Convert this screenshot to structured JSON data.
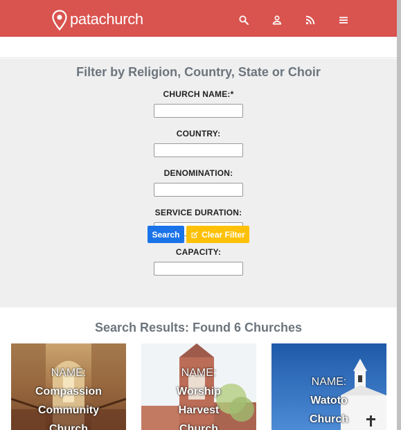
{
  "header": {
    "brand": "patachurch",
    "accent_color": "#d9534f",
    "icons": [
      "search-icon",
      "account-icon",
      "rss-icon",
      "menu-icon"
    ]
  },
  "filter": {
    "title": "Filter by Religion, Country, State or Choir",
    "fields": [
      {
        "label": "CHURCH NAME:*",
        "value": ""
      },
      {
        "label": "COUNTRY:",
        "value": ""
      },
      {
        "label": "DENOMINATION:",
        "value": ""
      },
      {
        "label": "SERVICE DURATION:",
        "value": ""
      },
      {
        "label": "CAPACITY:",
        "value": ""
      }
    ],
    "search_label": "Search",
    "clear_label": "Clear Filter"
  },
  "results": {
    "title": "Search Results: Found 6 Churches",
    "cards": [
      {
        "name_prefix": "NAME:",
        "name_lines": [
          "Compassion",
          "Community",
          "Church"
        ]
      },
      {
        "name_prefix": "NAME:",
        "name_lines": [
          "Worship",
          "Harvest",
          "Church"
        ]
      },
      {
        "name_prefix": "NAME:",
        "name_lines": [
          "Watoto",
          "Church"
        ]
      }
    ]
  }
}
